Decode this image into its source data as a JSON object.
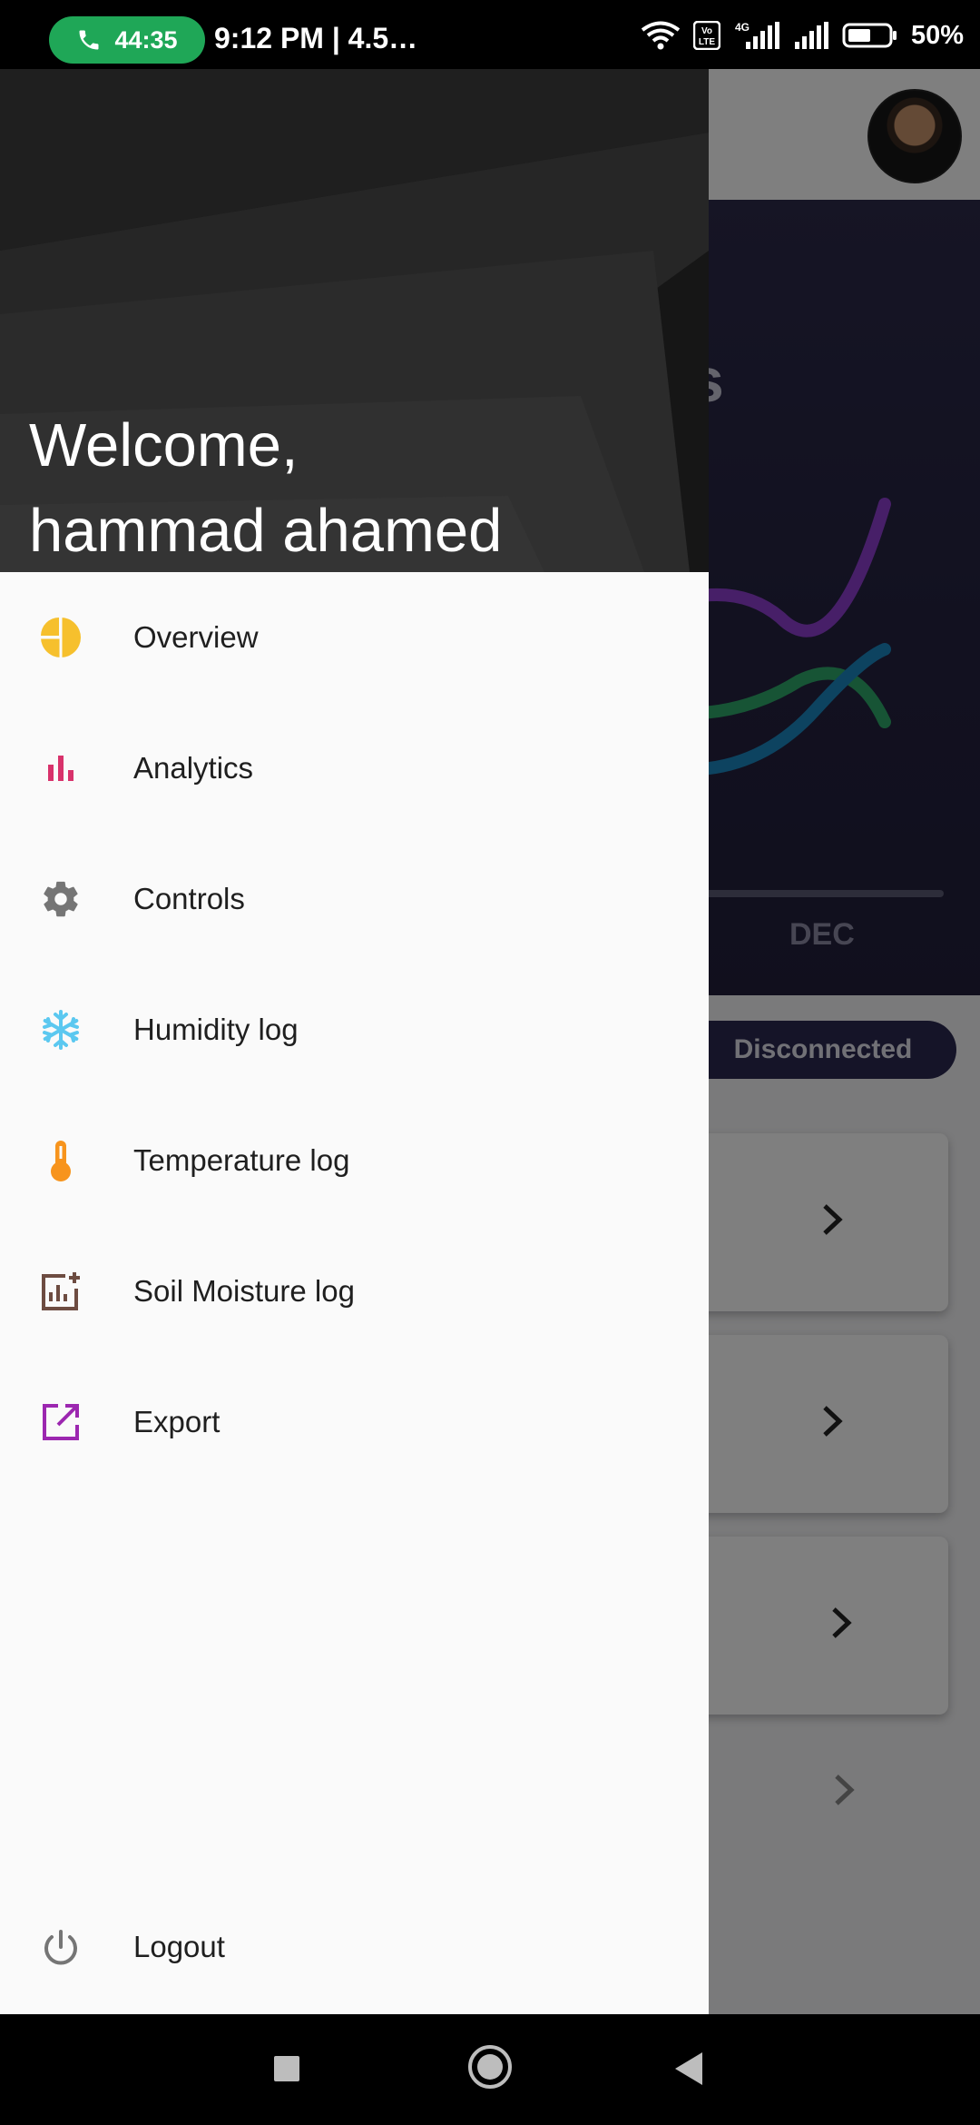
{
  "status_bar": {
    "call_timer": "44:35",
    "time_text": "9:12 PM |  4.5…",
    "volte_label": "Vo LTE",
    "network_label": "4G",
    "battery_percent": "50%"
  },
  "drawer": {
    "welcome_line1": "Welcome,",
    "welcome_line2": "hammad ahamed",
    "items": [
      {
        "label": "Overview",
        "icon": "pie-chart-icon",
        "color": "#f6c02d"
      },
      {
        "label": "Analytics",
        "icon": "bar-chart-icon",
        "color": "#d8326b"
      },
      {
        "label": "Controls",
        "icon": "gear-icon",
        "color": "#757575"
      },
      {
        "label": "Humidity log",
        "icon": "snowflake-icon",
        "color": "#5bc8f0"
      },
      {
        "label": "Temperature log",
        "icon": "thermometer-icon",
        "color": "#f7941d"
      },
      {
        "label": "Soil Moisture log",
        "icon": "add-chart-icon",
        "color": "#6d4c41"
      },
      {
        "label": "Export",
        "icon": "export-icon",
        "color": "#9c27b0"
      }
    ],
    "logout": {
      "label": "Logout",
      "icon": "power-icon",
      "color": "#757575"
    }
  },
  "background": {
    "chart_title_fragment": "s",
    "month_label": "DEC",
    "status_pill": "Disconnected",
    "series_colors": [
      "#8e3fd0",
      "#2fa86a",
      "#1b86c0"
    ]
  }
}
